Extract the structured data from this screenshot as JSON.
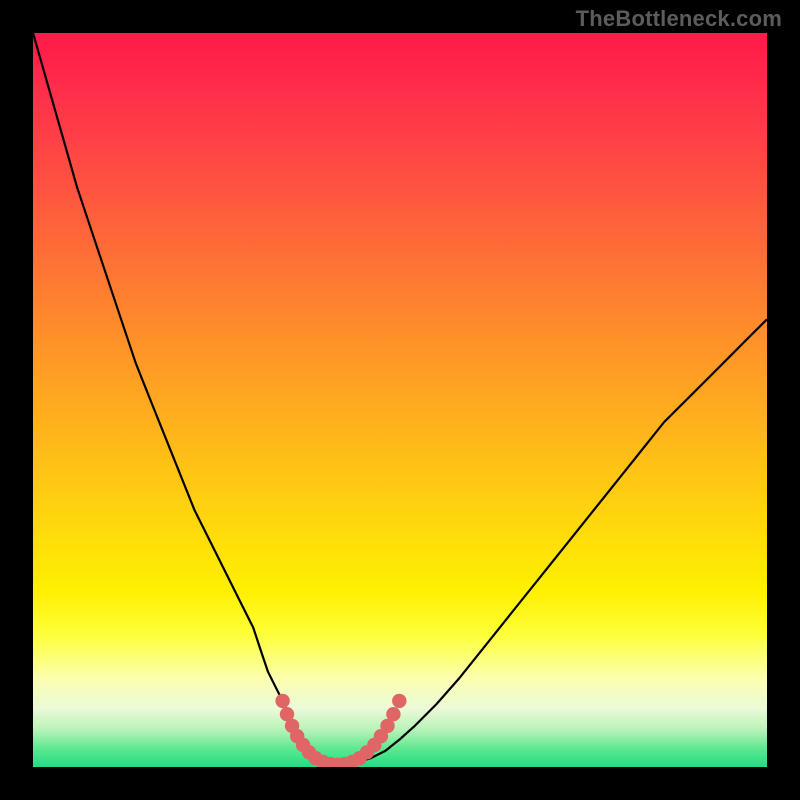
{
  "watermark": "TheBottleneck.com",
  "chart_data": {
    "type": "line",
    "title": "",
    "xlabel": "",
    "ylabel": "",
    "xlim": [
      0,
      100
    ],
    "ylim": [
      0,
      100
    ],
    "grid": false,
    "series": [
      {
        "name": "bottleneck-curve",
        "x": [
          0,
          2,
          4,
          6,
          8,
          10,
          12,
          14,
          16,
          18,
          20,
          22,
          24,
          26,
          28,
          30,
          31,
          32,
          33,
          34,
          35,
          36,
          37,
          38,
          39,
          40,
          41,
          42,
          43,
          44,
          46,
          48,
          50,
          52,
          55,
          58,
          62,
          66,
          70,
          74,
          78,
          82,
          86,
          90,
          94,
          98,
          100
        ],
        "y": [
          100,
          93,
          86,
          79,
          73,
          67,
          61,
          55,
          50,
          45,
          40,
          35,
          31,
          27,
          23,
          19,
          16,
          13,
          11,
          9,
          7,
          5,
          3.5,
          2.2,
          1.2,
          0.6,
          0.3,
          0.2,
          0.3,
          0.6,
          1.2,
          2.2,
          3.8,
          5.6,
          8.6,
          12,
          17,
          22,
          27,
          32,
          37,
          42,
          47,
          51,
          55,
          59,
          61
        ]
      }
    ],
    "markers": {
      "name": "highlight-dots",
      "color": "#e06666",
      "points": [
        {
          "x": 34.0,
          "y": 9.0
        },
        {
          "x": 34.6,
          "y": 7.2
        },
        {
          "x": 35.3,
          "y": 5.6
        },
        {
          "x": 36.0,
          "y": 4.2
        },
        {
          "x": 36.8,
          "y": 3.0
        },
        {
          "x": 37.6,
          "y": 2.0
        },
        {
          "x": 38.5,
          "y": 1.2
        },
        {
          "x": 39.5,
          "y": 0.7
        },
        {
          "x": 40.5,
          "y": 0.4
        },
        {
          "x": 41.5,
          "y": 0.3
        },
        {
          "x": 42.5,
          "y": 0.4
        },
        {
          "x": 43.5,
          "y": 0.7
        },
        {
          "x": 44.5,
          "y": 1.2
        },
        {
          "x": 45.5,
          "y": 2.0
        },
        {
          "x": 46.5,
          "y": 3.0
        },
        {
          "x": 47.4,
          "y": 4.2
        },
        {
          "x": 48.3,
          "y": 5.6
        },
        {
          "x": 49.1,
          "y": 7.2
        },
        {
          "x": 49.9,
          "y": 9.0
        }
      ]
    },
    "gradient_stops": [
      {
        "pos": 0.0,
        "color": "#ff1a4a"
      },
      {
        "pos": 0.5,
        "color": "#ffa820"
      },
      {
        "pos": 0.8,
        "color": "#fdff3a"
      },
      {
        "pos": 1.0,
        "color": "#1fde85"
      }
    ]
  }
}
